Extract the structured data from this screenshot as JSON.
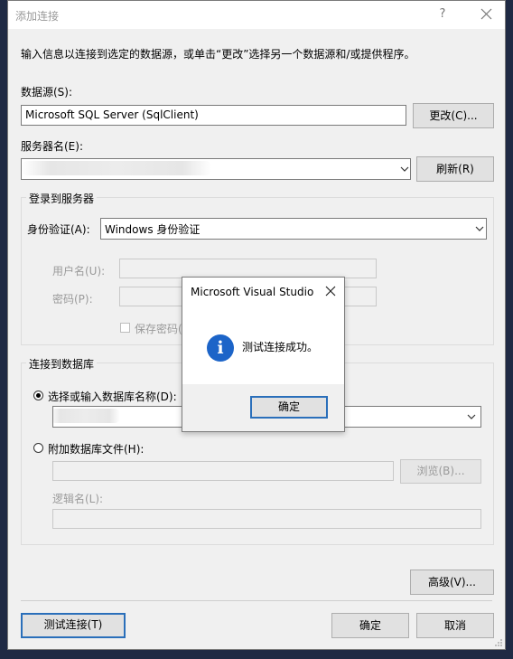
{
  "window": {
    "title": "添加连接",
    "help": "?"
  },
  "intro": "输入信息以连接到选定的数据源，或单击“更改”选择另一个数据源和/或提供程序。",
  "datasource": {
    "label": "数据源(S):",
    "value": "Microsoft SQL Server (SqlClient)",
    "change_button": "更改(C)..."
  },
  "server": {
    "label": "服务器名(E):",
    "value": "",
    "refresh_button": "刷新(R)"
  },
  "login_group": {
    "title": "登录到服务器",
    "auth_label": "身份验证(A):",
    "auth_value": "Windows 身份验证",
    "username_label": "用户名(U):",
    "password_label": "密码(P):",
    "save_password_label": "保存密码(S)"
  },
  "db_group": {
    "title": "连接到数据库",
    "select_db_label": "选择或输入数据库名称(D):",
    "attach_file_label": "附加数据库文件(H):",
    "browse_button": "浏览(B)...",
    "logical_name_label": "逻辑名(L):"
  },
  "footer": {
    "advanced_button": "高级(V)...",
    "test_button": "测试连接(T)",
    "ok_button": "确定",
    "cancel_button": "取消"
  },
  "message_box": {
    "title": "Microsoft Visual Studio",
    "message": "测试连接成功。",
    "ok_button": "确定"
  },
  "colors": {
    "accent": "#2a6fba",
    "info_icon": "#1c64c8",
    "dialog_bg": "#f0f0f0",
    "backdrop": "#1f2a44"
  },
  "icons": [
    "close-icon",
    "chevron-down-icon",
    "info-icon",
    "resize-grip-icon"
  ]
}
